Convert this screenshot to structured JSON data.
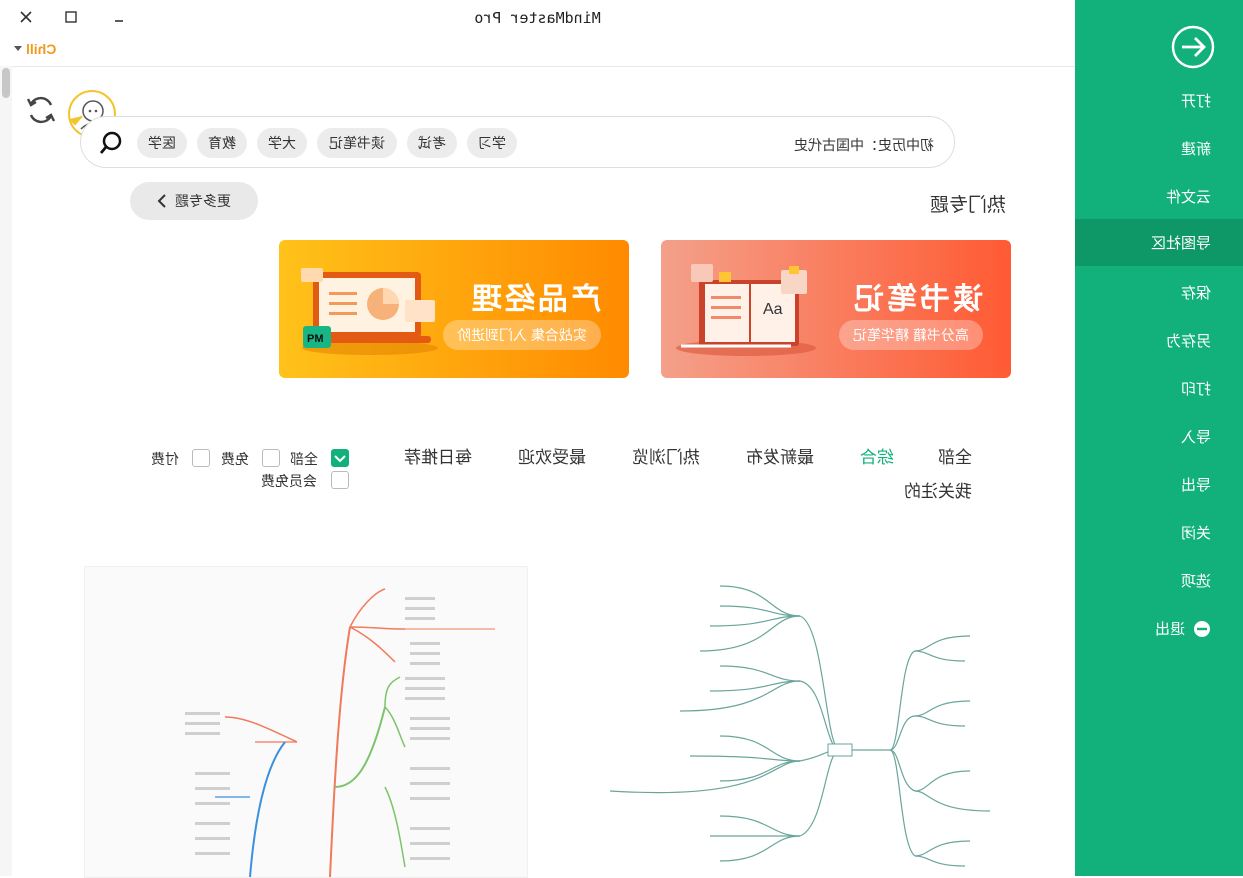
{
  "window": {
    "title": "MindMaster Pro",
    "user": "Chill",
    "controls": [
      "close",
      "maximize",
      "minimize"
    ]
  },
  "sidebar": {
    "accent": "#12b07a",
    "items": [
      {
        "label": "打开"
      },
      {
        "label": "新建"
      },
      {
        "label": "云文件"
      },
      {
        "label": "导图社区",
        "active": true
      },
      {
        "label": "保存"
      },
      {
        "label": "另存为"
      },
      {
        "label": "打印"
      },
      {
        "label": "导入"
      },
      {
        "label": "导出"
      },
      {
        "label": "关闭"
      },
      {
        "label": "选项"
      },
      {
        "label": "退出"
      }
    ]
  },
  "search": {
    "query": "初中历史：中国古代史",
    "chips": [
      "学习",
      "考试",
      "读书笔记",
      "大学",
      "教育",
      "医学"
    ]
  },
  "section": {
    "title": "热门专题",
    "more_label": "更多专题"
  },
  "banners": [
    {
      "title": "读书笔记",
      "subtitle": "高分书籍 精华笔记",
      "color": "#ff6b4a"
    },
    {
      "title": "产品经理",
      "subtitle": "实战合集 入门到进阶",
      "color": "#ff9a10"
    }
  ],
  "tabs": [
    "全部",
    "综合",
    "最新发布",
    "热门浏览",
    "最受欢迎",
    "每日推荐",
    "我关注的"
  ],
  "active_tab": "综合",
  "filters": [
    {
      "label": "全部",
      "checked": true
    },
    {
      "label": "免费",
      "checked": false
    },
    {
      "label": "付费",
      "checked": false
    },
    {
      "label": "会员免费",
      "checked": false
    }
  ]
}
